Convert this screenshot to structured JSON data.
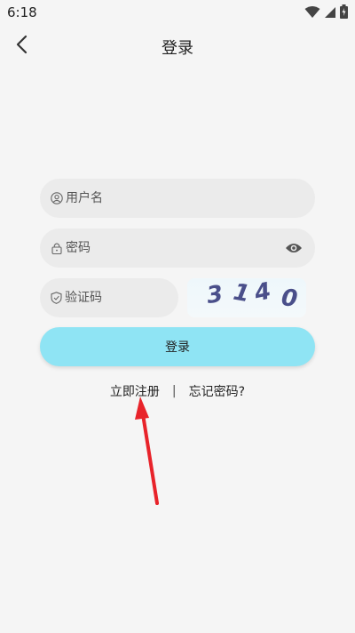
{
  "status_bar": {
    "time": "6:18",
    "icons": [
      "wifi-icon",
      "signal-icon",
      "battery-charging-icon"
    ]
  },
  "app_bar": {
    "title": "登录",
    "back_icon": "arrow-back-icon"
  },
  "form": {
    "username": {
      "placeholder": "用户名",
      "value": "",
      "icon": "user-icon"
    },
    "password": {
      "placeholder": "密码",
      "value": "",
      "icon": "lock-icon",
      "toggle_icon": "eye-icon"
    },
    "captcha": {
      "placeholder": "验证码",
      "value": "",
      "icon": "shield-icon"
    },
    "captcha_image": {
      "chars": [
        "3",
        "1",
        "4",
        "0"
      ]
    },
    "login_label": "登录"
  },
  "links": {
    "register": "立即注册",
    "separator": "|",
    "forgot": "忘记密码?"
  },
  "annotation": {
    "color": "#e8232a"
  },
  "colors": {
    "background": "#f5f5f5",
    "field_bg": "#ebebeb",
    "login_button": "#8fe4f4",
    "captcha_text": "#4a4f8a"
  }
}
